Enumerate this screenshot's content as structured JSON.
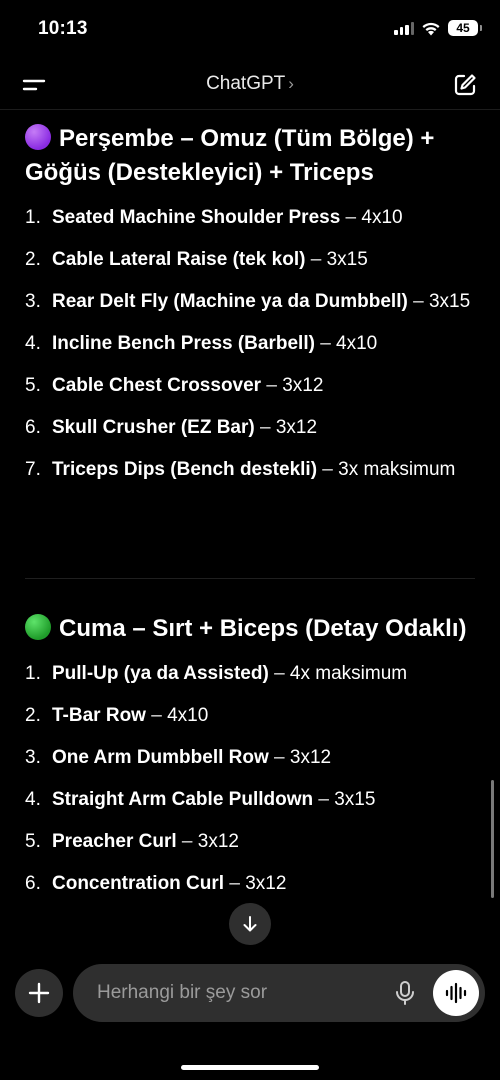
{
  "status_bar": {
    "time": "10:13",
    "battery": "45"
  },
  "header": {
    "title": "ChatGPT",
    "chevron": "›"
  },
  "sections": [
    {
      "emoji_color": "#9b30ff",
      "title": "Perşembe – Omuz (Tüm Bölge) + Göğüs (Destekleyici) + Triceps",
      "items": [
        {
          "num": "1.",
          "exercise": "Seated Machine Shoulder Press",
          "detail": "4x10"
        },
        {
          "num": "2.",
          "exercise": "Cable Lateral Raise (tek kol)",
          "detail": "3x15"
        },
        {
          "num": "3.",
          "exercise": "Rear Delt Fly (Machine ya da Dumbbell)",
          "detail": "3x15"
        },
        {
          "num": "4.",
          "exercise": "Incline Bench Press (Barbell)",
          "detail": "4x10"
        },
        {
          "num": "5.",
          "exercise": "Cable Chest Crossover",
          "detail": "3x12"
        },
        {
          "num": "6.",
          "exercise": "Skull Crusher (EZ Bar)",
          "detail": "3x12"
        },
        {
          "num": "7.",
          "exercise": "Triceps Dips (Bench destekli)",
          "detail": "3x maksimum"
        }
      ]
    },
    {
      "emoji_color": "#2ecc40",
      "title": "Cuma – Sırt + Biceps (Detay Odaklı)",
      "items": [
        {
          "num": "1.",
          "exercise": "Pull-Up (ya da Assisted)",
          "detail": "4x maksimum"
        },
        {
          "num": "2.",
          "exercise": "T-Bar Row",
          "detail": "4x10"
        },
        {
          "num": "3.",
          "exercise": "One Arm Dumbbell Row",
          "detail": "3x12"
        },
        {
          "num": "4.",
          "exercise": "Straight Arm Cable Pulldown",
          "detail": "3x15"
        },
        {
          "num": "5.",
          "exercise": "Preacher Curl",
          "detail": "3x12"
        },
        {
          "num": "6.",
          "exercise": "Concentration Curl",
          "detail": "3x12"
        }
      ]
    }
  ],
  "composer": {
    "placeholder": "Herhangi bir şey sor"
  },
  "icons": {
    "menu": "menu-icon",
    "new_chat": "new-chat-icon",
    "plus": "plus-icon",
    "mic": "mic-icon",
    "voice": "voice-waveform-icon",
    "scroll_down": "arrow-down-icon"
  }
}
